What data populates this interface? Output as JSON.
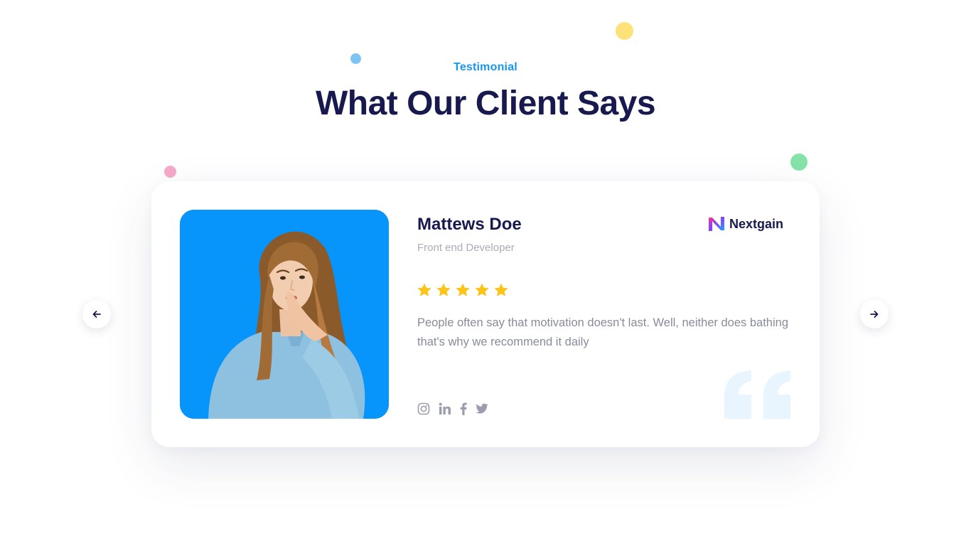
{
  "section": {
    "eyebrow": "Testimonial",
    "heading": "What Our Client Says"
  },
  "navigation": {
    "prev_icon": "arrow-left-icon",
    "next_icon": "arrow-right-icon"
  },
  "testimonial": {
    "name": "Mattews Doe",
    "role": "Front end Developer",
    "company": "Nextgain",
    "company_logo_icon": "nextgain-logo-icon",
    "rating": 5,
    "rating_max": 5,
    "quote": "People often say that motivation doesn't last. Well, neither does bathing that's why we recommend it daily",
    "photo_icon": "client-photo",
    "socials": [
      "instagram-icon",
      "linkedin-icon",
      "facebook-icon",
      "twitter-icon"
    ]
  },
  "colors": {
    "accent": "#1796f0",
    "heading": "#18194f",
    "star": "#fcc419",
    "photo_background": "#0795fb",
    "body_text": "#888b9b",
    "muted_text": "#a9acb9"
  }
}
